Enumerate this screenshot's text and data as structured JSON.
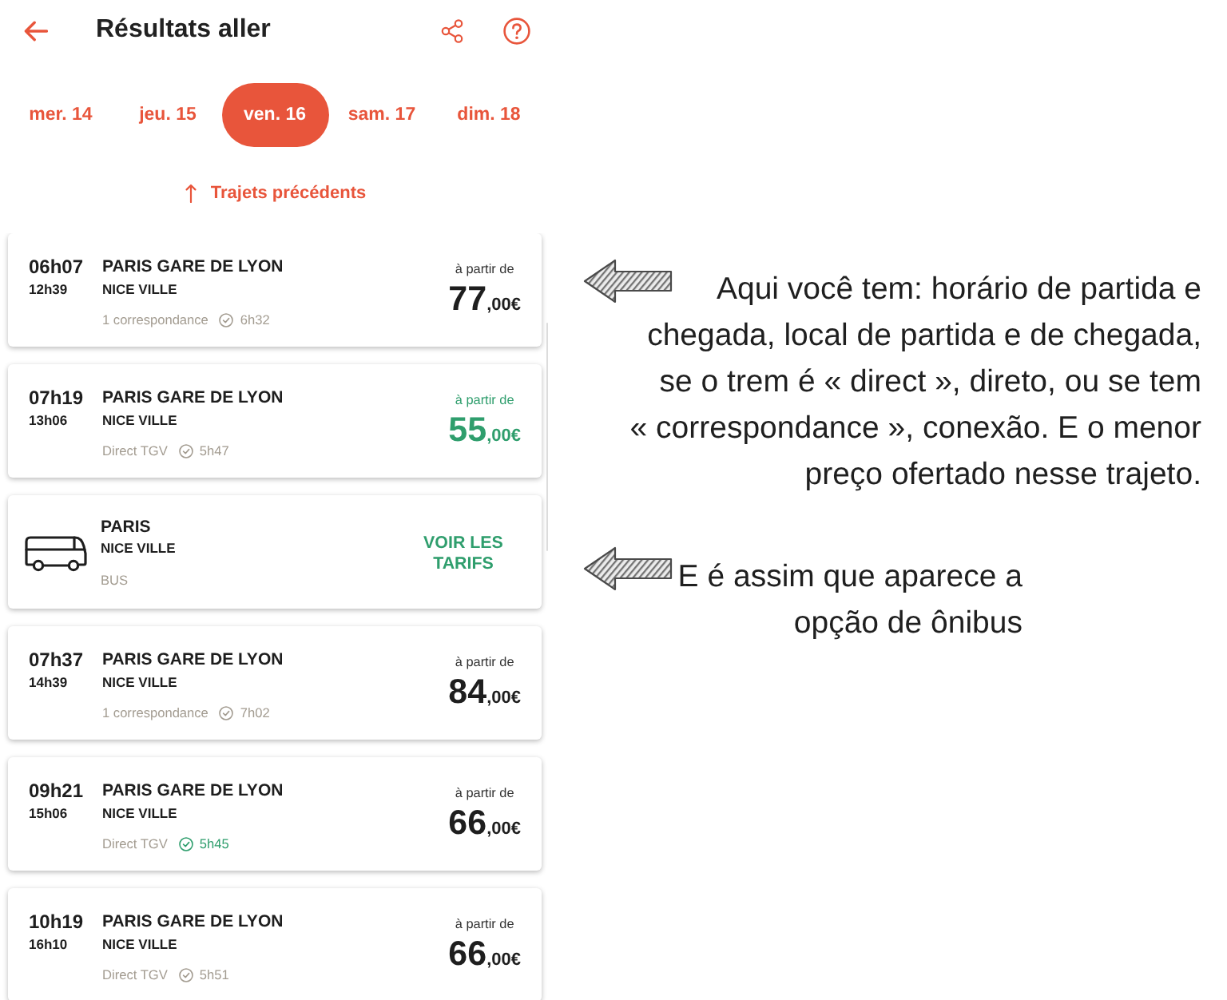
{
  "header": {
    "title": "Résultats aller"
  },
  "dates": [
    {
      "label": "mer. 14",
      "selected": false
    },
    {
      "label": "jeu. 15",
      "selected": false
    },
    {
      "label": "ven. 16",
      "selected": true
    },
    {
      "label": "sam. 17",
      "selected": false
    },
    {
      "label": "dim. 18",
      "selected": false
    }
  ],
  "previous_trips": {
    "label": "Trajets précédents"
  },
  "results": [
    {
      "kind": "train",
      "departure": "06h07",
      "arrival": "12h39",
      "origin": "PARIS GARE DE LYON",
      "destination": "NICE VILLE",
      "service": "1 correspondance",
      "duration": "6h32",
      "duration_highlighted": false,
      "price_label": "à partir de",
      "price": "77",
      "price_decimals": ",00€",
      "price_highlighted": false
    },
    {
      "kind": "train",
      "departure": "07h19",
      "arrival": "13h06",
      "origin": "PARIS GARE DE LYON",
      "destination": "NICE VILLE",
      "service": "Direct TGV",
      "duration": "5h47",
      "duration_highlighted": false,
      "price_label": "à partir de",
      "price": "55",
      "price_decimals": ",00€",
      "price_highlighted": true
    },
    {
      "kind": "bus",
      "origin": "PARIS",
      "destination": "NICE VILLE",
      "service": "BUS",
      "action": "VOIR LES TARIFS"
    },
    {
      "kind": "train",
      "departure": "07h37",
      "arrival": "14h39",
      "origin": "PARIS GARE DE LYON",
      "destination": "NICE VILLE",
      "service": "1 correspondance",
      "duration": "7h02",
      "duration_highlighted": false,
      "price_label": "à partir de",
      "price": "84",
      "price_decimals": ",00€",
      "price_highlighted": false
    },
    {
      "kind": "train",
      "departure": "09h21",
      "arrival": "15h06",
      "origin": "PARIS GARE DE LYON",
      "destination": "NICE VILLE",
      "service": "Direct TGV",
      "duration": "5h45",
      "duration_highlighted": true,
      "price_label": "à partir de",
      "price": "66",
      "price_decimals": ",00€",
      "price_highlighted": false
    },
    {
      "kind": "train",
      "departure": "10h19",
      "arrival": "16h10",
      "origin": "PARIS GARE DE LYON",
      "destination": "NICE VILLE",
      "service": "Direct TGV",
      "duration": "5h51",
      "duration_highlighted": false,
      "price_label": "à partir de",
      "price": "66",
      "price_decimals": ",00€",
      "price_highlighted": false
    }
  ],
  "annotations": [
    {
      "text": "Aqui você tem: horário de partida e\nchegada, local de partida e de chegada,\nse o trem é « direct », direto, ou se tem\n« correspondance », conexão. E o menor\npreço ofertado nesse trajeto."
    },
    {
      "text": "E é assim que aparece a\nopção de ônibus"
    }
  ]
}
